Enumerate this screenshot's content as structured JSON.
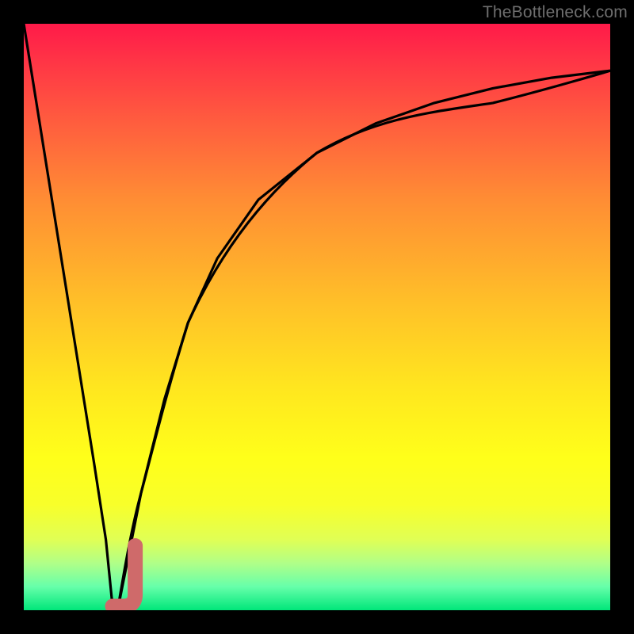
{
  "watermark": {
    "text": "TheBottleneck.com"
  },
  "colors": {
    "frame": "#000000",
    "curve": "#000000",
    "marker": "#cf6a6a",
    "gradient_top": "#ff1a49",
    "gradient_mid": "#ffff1a",
    "gradient_bottom": "#00e67a"
  },
  "chart_data": {
    "type": "line",
    "title": "",
    "xlabel": "",
    "ylabel": "",
    "xlim": [
      0,
      100
    ],
    "ylim": [
      0,
      100
    ],
    "grid": false,
    "legend": false,
    "series": [
      {
        "name": "left-branch",
        "x": [
          0,
          4,
          8,
          12,
          14,
          15,
          16
        ],
        "values": [
          100,
          75,
          50,
          25,
          12,
          2,
          0
        ]
      },
      {
        "name": "right-branch",
        "x": [
          16,
          18,
          20,
          24,
          28,
          33,
          40,
          50,
          60,
          70,
          80,
          90,
          100
        ],
        "values": [
          0,
          10,
          20,
          36,
          49,
          60,
          70,
          78,
          83,
          86.5,
          89,
          90.8,
          92
        ]
      }
    ],
    "marker": {
      "name": "J-marker",
      "shape": "J",
      "x_range": [
        14.5,
        19
      ],
      "y_range": [
        0,
        11
      ],
      "color": "#cf6a6a"
    },
    "note": "Background is a vertical gradient red→yellow→green; curve is a V that bottoms near x≈16 then rises logarithmically."
  }
}
